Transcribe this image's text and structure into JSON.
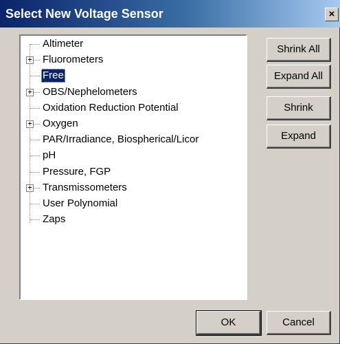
{
  "window": {
    "title": "Select New Voltage Sensor",
    "close_label": "×"
  },
  "tree": {
    "items": [
      {
        "label": "Altimeter",
        "has_children": false,
        "selected": false
      },
      {
        "label": "Fluorometers",
        "has_children": true,
        "selected": false
      },
      {
        "label": "Free",
        "has_children": false,
        "selected": true
      },
      {
        "label": "OBS/Nephelometers",
        "has_children": true,
        "selected": false
      },
      {
        "label": "Oxidation Reduction Potential",
        "has_children": false,
        "selected": false
      },
      {
        "label": "Oxygen",
        "has_children": true,
        "selected": false
      },
      {
        "label": "PAR/Irradiance, Biospherical/Licor",
        "has_children": false,
        "selected": false
      },
      {
        "label": "pH",
        "has_children": false,
        "selected": false
      },
      {
        "label": "Pressure, FGP",
        "has_children": false,
        "selected": false
      },
      {
        "label": "Transmissometers",
        "has_children": true,
        "selected": false
      },
      {
        "label": "User Polynomial",
        "has_children": false,
        "selected": false
      },
      {
        "label": "Zaps",
        "has_children": false,
        "selected": false
      }
    ],
    "expander_glyph": "+"
  },
  "buttons": {
    "shrink_all": "Shrink All",
    "expand_all": "Expand All",
    "shrink": "Shrink",
    "expand": "Expand",
    "ok": "OK",
    "cancel": "Cancel"
  },
  "colors": {
    "titlebar_start": "#0a246a",
    "titlebar_end": "#a6caf0",
    "dialog_face": "#d4d0c8",
    "selection": "#0a246a"
  }
}
